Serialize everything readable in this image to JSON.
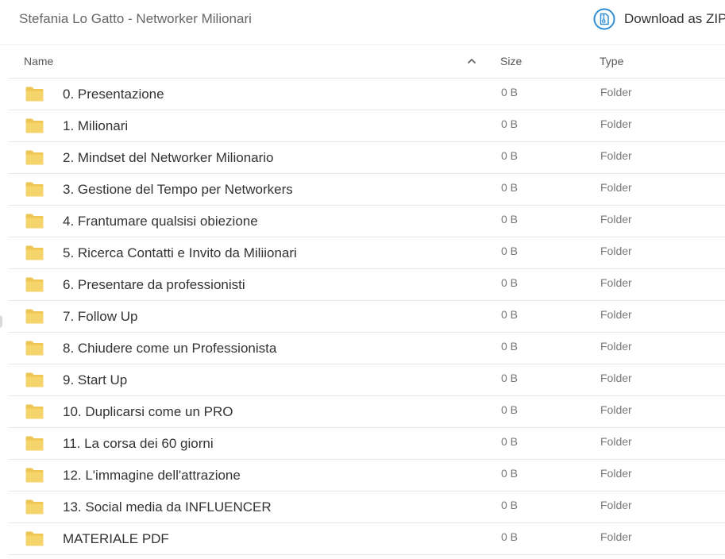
{
  "header": {
    "title": "Stefania Lo Gatto - Networker Milionari",
    "download_label": "Download as ZIP",
    "download_icon": "zip-archive-icon"
  },
  "columns": {
    "name": "Name",
    "size": "Size",
    "type": "Type",
    "sort": "ascending",
    "sort_icon": "chevron-up-icon"
  },
  "folder_icon": "folder-icon",
  "colors": {
    "folder_fill": "#F6D46C",
    "folder_tab": "#EEC552",
    "accent": "#2D8DD6",
    "divider": "#E6E6E6"
  },
  "rows": [
    {
      "name": "0. Presentazione",
      "size": "0 B",
      "type": "Folder"
    },
    {
      "name": "1. Milionari",
      "size": "0 B",
      "type": "Folder"
    },
    {
      "name": "2. Mindset del Networker Milionario",
      "size": "0 B",
      "type": "Folder"
    },
    {
      "name": "3. Gestione del Tempo per Networkers",
      "size": "0 B",
      "type": "Folder"
    },
    {
      "name": "4. Frantumare qualsisi obiezione",
      "size": "0 B",
      "type": "Folder"
    },
    {
      "name": "5. Ricerca Contatti e Invito da Miliionari",
      "size": "0 B",
      "type": "Folder"
    },
    {
      "name": "6. Presentare da professionisti",
      "size": "0 B",
      "type": "Folder"
    },
    {
      "name": "7. Follow Up",
      "size": "0 B",
      "type": "Folder"
    },
    {
      "name": "8. Chiudere come un Professionista",
      "size": "0 B",
      "type": "Folder"
    },
    {
      "name": "9. Start Up",
      "size": "0 B",
      "type": "Folder"
    },
    {
      "name": "10. Duplicarsi come un PRO",
      "size": "0 B",
      "type": "Folder"
    },
    {
      "name": "11. La corsa dei 60 giorni",
      "size": "0 B",
      "type": "Folder"
    },
    {
      "name": "12. L'immagine dell'attrazione",
      "size": "0 B",
      "type": "Folder"
    },
    {
      "name": "13. Social media da INFLUENCER",
      "size": "0 B",
      "type": "Folder"
    },
    {
      "name": "MATERIALE PDF",
      "size": "0 B",
      "type": "Folder"
    }
  ]
}
